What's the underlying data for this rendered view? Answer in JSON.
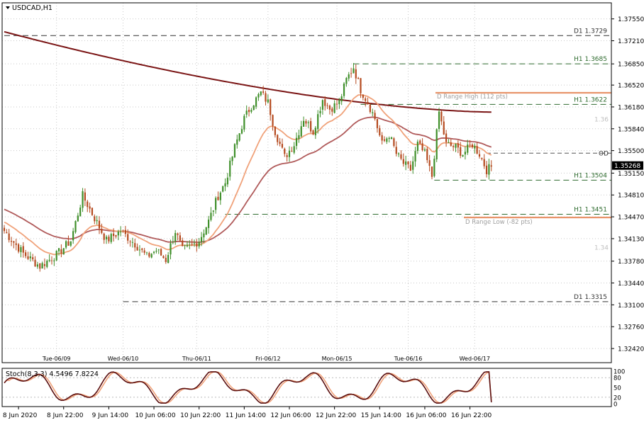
{
  "header": {
    "symbol_label": "USDCAD,H1"
  },
  "colors": {
    "bull": "#3f8f2a",
    "bear": "#b54a1f",
    "ma200": "#7a1414",
    "ma50": "#b05a5a",
    "ma20": "#f0a27a",
    "level_daily": "#333333",
    "level_h1": "#2e6b2e",
    "range": "#e8946a",
    "stoch_main": "#5a0e0e",
    "stoch_signal": "#f0a27a",
    "grid": "#c9c9c9",
    "current_bg": "#000000"
  },
  "price_axis": {
    "ticks": [
      "1.37550",
      "1.37210",
      "1.36850",
      "1.36520",
      "1.36180",
      "1.35840",
      "1.35500",
      "1.35150",
      "1.34810",
      "1.34470",
      "1.34130",
      "1.33780",
      "1.33440",
      "1.33100",
      "1.32760",
      "1.32420"
    ],
    "current_price": "1.35268"
  },
  "time_labels": {
    "upper": [
      "Tue-06/09",
      "Wed-06/10",
      "Thu-06/11",
      "Fri-06/12",
      "Mon-06/15",
      "Tue-06/16",
      "Wed-06/17"
    ],
    "bottom": [
      "8 Jun 2020",
      "8 Jun 22:00",
      "9 Jun 14:00",
      "10 Jun 06:00",
      "10 Jun 22:00",
      "11 Jun 14:00",
      "12 Jun 06:00",
      "12 Jun 22:00",
      "15 Jun 14:00",
      "16 Jun 06:00",
      "16 Jun 22:00"
    ]
  },
  "levels": [
    {
      "label": "D1 1.3729",
      "price": 1.3729,
      "kind": "daily"
    },
    {
      "label": "H1 1.3685",
      "price": 1.3685,
      "kind": "h1"
    },
    {
      "label": "H1 1.3622",
      "price": 1.3622,
      "kind": "h1"
    },
    {
      "label": "H1 1.3504",
      "price": 1.3504,
      "kind": "h1"
    },
    {
      "label": "H1 1.3451",
      "price": 1.3451,
      "kind": "h1"
    },
    {
      "label": "D1 1.3315",
      "price": 1.3315,
      "kind": "daily"
    }
  ],
  "range_lines": [
    {
      "label": "D Range High (112 pts)",
      "price": 1.364
    },
    {
      "label": "D Range Low (-82 pts)",
      "price": 1.3446
    }
  ],
  "misc_labels": {
    "od": "OD",
    "round_136": "1.36",
    "round_134": "1.34"
  },
  "stochastic": {
    "label": "Stoch(8,3,3) 4.5496 7.8224",
    "axis_ticks": [
      "100",
      "80",
      "50",
      "20",
      "0"
    ],
    "main_value": 4.5496,
    "signal_value": 7.8224
  },
  "chart_data": {
    "type": "candlestick",
    "title": "USDCAD,H1",
    "ylim": [
      1.322,
      1.378
    ],
    "series": [
      {
        "name": "close",
        "anchors": [
          [
            0,
            1.3425
          ],
          [
            8,
            1.339
          ],
          [
            15,
            1.337
          ],
          [
            22,
            1.3388
          ],
          [
            28,
            1.341
          ],
          [
            33,
            1.348
          ],
          [
            38,
            1.3445
          ],
          [
            43,
            1.341
          ],
          [
            49,
            1.3425
          ],
          [
            55,
            1.3405
          ],
          [
            60,
            1.3385
          ],
          [
            64,
            1.3395
          ],
          [
            68,
            1.338
          ],
          [
            72,
            1.3425
          ],
          [
            75,
            1.3395
          ],
          [
            78,
            1.34
          ],
          [
            82,
            1.341
          ],
          [
            86,
            1.344
          ],
          [
            90,
            1.348
          ],
          [
            93,
            1.35
          ],
          [
            97,
            1.3555
          ],
          [
            101,
            1.36
          ],
          [
            104,
            1.362
          ],
          [
            108,
            1.364
          ],
          [
            111,
            1.3625
          ],
          [
            114,
            1.358
          ],
          [
            118,
            1.354
          ],
          [
            122,
            1.356
          ],
          [
            126,
            1.36
          ],
          [
            130,
            1.358
          ],
          [
            134,
            1.363
          ],
          [
            137,
            1.3615
          ],
          [
            141,
            1.3625
          ],
          [
            144,
            1.366
          ],
          [
            147,
            1.368
          ],
          [
            150,
            1.3645
          ],
          [
            153,
            1.3625
          ],
          [
            156,
            1.36
          ],
          [
            159,
            1.356
          ],
          [
            162,
            1.3575
          ],
          [
            165,
            1.3545
          ],
          [
            168,
            1.353
          ],
          [
            171,
            1.352
          ],
          [
            174,
            1.356
          ],
          [
            177,
            1.3545
          ],
          [
            180,
            1.351
          ],
          [
            183,
            1.361
          ],
          [
            186,
            1.356
          ],
          [
            190,
            1.3555
          ],
          [
            193,
            1.3545
          ],
          [
            197,
            1.356
          ],
          [
            200,
            1.3545
          ],
          [
            203,
            1.352
          ],
          [
            205,
            1.3525
          ]
        ]
      }
    ]
  }
}
